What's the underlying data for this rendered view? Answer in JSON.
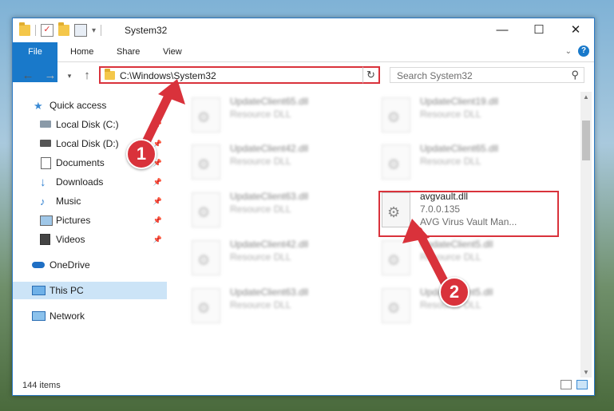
{
  "window": {
    "title": "System32"
  },
  "ribbon": {
    "tabs": [
      "File",
      "Home",
      "Share",
      "View"
    ]
  },
  "address": {
    "path": "C:\\Windows\\System32"
  },
  "search": {
    "placeholder": "Search System32"
  },
  "sidebar": {
    "items": [
      {
        "label": "Quick access",
        "icon": "star-icon",
        "pinned": false
      },
      {
        "label": "Local Disk (C:)",
        "icon": "drive-icon",
        "pinned": true
      },
      {
        "label": "Local Disk (D:)",
        "icon": "drive-icon",
        "pinned": true
      },
      {
        "label": "Documents",
        "icon": "documents-icon",
        "pinned": true
      },
      {
        "label": "Downloads",
        "icon": "download-icon",
        "pinned": true
      },
      {
        "label": "Music",
        "icon": "music-icon",
        "pinned": true
      },
      {
        "label": "Pictures",
        "icon": "pictures-icon",
        "pinned": true
      },
      {
        "label": "Videos",
        "icon": "videos-icon",
        "pinned": true
      },
      {
        "label": "OneDrive",
        "icon": "cloud-icon",
        "pinned": false
      },
      {
        "label": "This PC",
        "icon": "computer-icon",
        "pinned": false,
        "selected": true
      },
      {
        "label": "Network",
        "icon": "network-icon",
        "pinned": false
      }
    ]
  },
  "files": [
    {
      "name": "UpdateClient65.dll",
      "desc": "Resource DLL"
    },
    {
      "name": "UpdateClient19.dll",
      "desc": "Resource DLL"
    },
    {
      "name": "UpdateClient42.dll",
      "desc": "Resource DLL"
    },
    {
      "name": "UpdateClient65.dll",
      "desc": "Resource DLL"
    },
    {
      "name": "UpdateClient63.dll",
      "desc": "Resource DLL"
    },
    {
      "name": "avgvault.dll",
      "version": "7.0.0.135",
      "desc": "AVG Virus Vault Man..."
    },
    {
      "name": "UpdateClient42.dll",
      "desc": "Resource DLL"
    },
    {
      "name": "UpdateClient5.dll",
      "desc": "Resource DLL"
    },
    {
      "name": "UpdateClient63.dll",
      "desc": "Resource DLL"
    },
    {
      "name": "UpdateClient5.dll",
      "desc": "Resource DLL"
    }
  ],
  "status": {
    "count": "144 items"
  },
  "annotations": {
    "step1": "1",
    "step2": "2",
    "color": "#d9323b"
  }
}
